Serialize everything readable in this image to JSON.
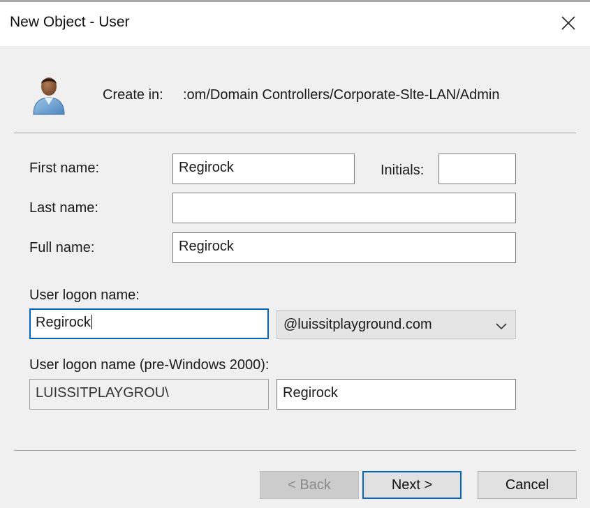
{
  "window": {
    "title": "New Object - User",
    "close_icon": "close-icon"
  },
  "header": {
    "user_icon": "user-icon",
    "create_in_label": "Create in:",
    "create_in_path": ":om/Domain Controllers/Corporate-Slte-LAN/Admin"
  },
  "form": {
    "first_name": {
      "label": "First name:",
      "value": "Regirock"
    },
    "initials": {
      "label": "Initials:",
      "value": ""
    },
    "last_name": {
      "label": "Last name:",
      "value": ""
    },
    "full_name": {
      "label": "Full name:",
      "value": "Regirock"
    },
    "logon_name": {
      "label": "User logon name:",
      "value": "Regirock"
    },
    "upn_suffix": {
      "value": "@luissitplayground.com",
      "arrow_icon": "chevron-down-icon"
    },
    "pre2000": {
      "label": "User logon name (pre-Windows 2000):",
      "domain": "LUISSITPLAYGROU\\",
      "value": "Regirock"
    }
  },
  "buttons": {
    "back": "< Back",
    "next": "Next >",
    "cancel": "Cancel"
  },
  "colors": {
    "accent": "#0067c0",
    "dialog_bg": "#f0f0f0",
    "disabled_button": "#cccccc"
  }
}
